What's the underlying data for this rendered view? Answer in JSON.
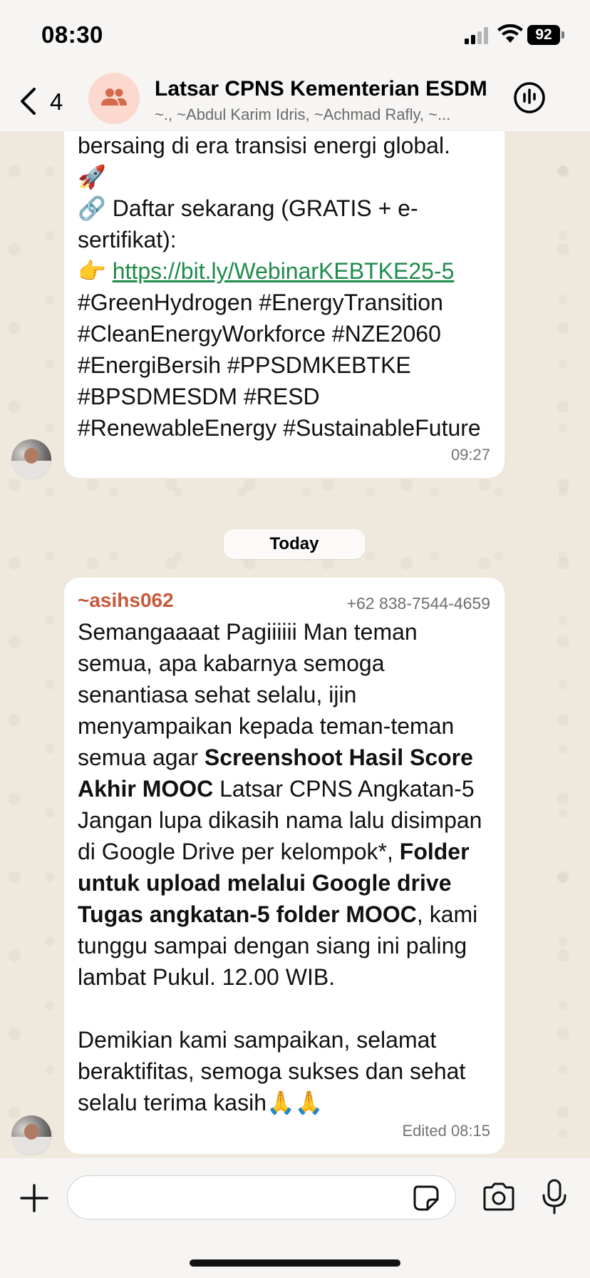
{
  "status_bar": {
    "time": "08:30",
    "battery": "92"
  },
  "header": {
    "back_count": "4",
    "title": "Latsar CPNS Kementerian ESDM",
    "subtitle": "~., ~Abdul Karim Idris, ~Achmad Rafly, ~..."
  },
  "messages": [
    {
      "lines_before_link": "bersaing di era transisi energi global.\n🚀\n🔗 Daftar sekarang (GRATIS + e-sertifikat):\n👉 ",
      "link": "https://bit.ly/WebinarKEBTKE25-5",
      "lines_after_link": "\n#GreenHydrogen #EnergyTransition #CleanEnergyWorkforce #NZE2060 #EnergiBersih #PPSDMKEBTKE #BPSDMESDM #RESD #RenewableEnergy #SustainableFuture",
      "time": "09:27"
    },
    {
      "sender": "~asihs062",
      "phone": "+62 838-7544-4659",
      "text_1": "Semangaaaat Pagiiiiii Man teman semua, apa kabarnya semoga senantiasa sehat selalu, ijin menyampaikan kepada teman-teman semua agar ",
      "bold_1": "Screenshoot Hasil Score Akhir MOOC",
      "text_2": " Latsar CPNS Angkatan-5 Jangan lupa dikasih nama lalu disimpan di Google Drive per kelompok*, ",
      "bold_2": "Folder untuk upload melalui Google drive Tugas angkatan-5 folder MOOC",
      "text_3": ", kami tunggu sampai dengan siang ini paling lambat Pukul. 12.00 WIB.\n\nDemikian kami sampaikan, selamat beraktifitas, semoga sukses dan sehat selalu terima kasih🙏🙏",
      "time": "Edited 08:15"
    }
  ],
  "date_divider": "Today",
  "input": {
    "placeholder": ""
  },
  "icons": {
    "back": "chevron-left-icon",
    "group": "people-icon",
    "call": "voice-call-icon",
    "plus": "plus-icon",
    "sticker": "sticker-icon",
    "camera": "camera-icon",
    "mic": "microphone-icon"
  },
  "colors": {
    "link": "#1f8b4c",
    "sender": "#c8583a",
    "avatar_bg": "#fbd9cf"
  }
}
